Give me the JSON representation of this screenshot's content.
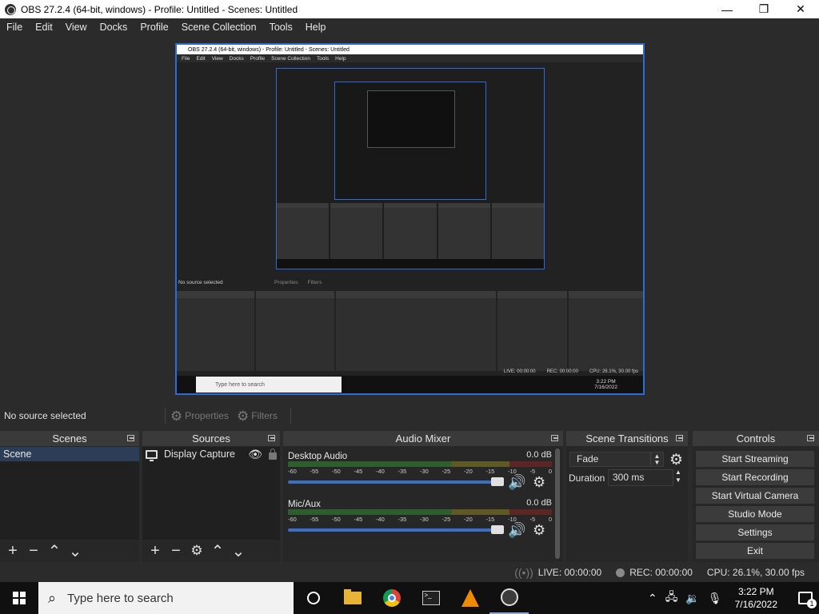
{
  "window": {
    "title": "OBS 27.2.4 (64-bit, windows) - Profile: Untitled - Scenes: Untitled",
    "minimize": "—",
    "maximize": "❐",
    "close": "✕"
  },
  "menu": [
    "File",
    "Edit",
    "View",
    "Docks",
    "Profile",
    "Scene Collection",
    "Tools",
    "Help"
  ],
  "preview": {
    "title": "OBS 27.2.4 (64-bit, windows) - Profile: Untitled - Scenes: Untitled",
    "menu": [
      "File",
      "Edit",
      "View",
      "Docks",
      "Profile",
      "Scene Collection",
      "Tools",
      "Help"
    ],
    "no_source": "No source selected",
    "properties": "Properties",
    "filters": "Filters",
    "status_live": "LIVE: 00:00:00",
    "status_rec": "REC: 00:00:00",
    "status_cpu": "CPU: 26.1%, 30.00 fps",
    "search": "Type here to search",
    "time": "3:22 PM",
    "date": "7/16/2022"
  },
  "source_toolbar": {
    "no_source": "No source selected",
    "properties": "Properties",
    "filters": "Filters"
  },
  "docks": {
    "scenes": {
      "title": "Scenes",
      "items": [
        "Scene"
      ]
    },
    "sources": {
      "title": "Sources",
      "items": [
        "Display Capture"
      ]
    },
    "mixer": {
      "title": "Audio Mixer",
      "ticks": [
        "-60",
        "-55",
        "-50",
        "-45",
        "-40",
        "-35",
        "-30",
        "-25",
        "-20",
        "-15",
        "-10",
        "-5",
        "0"
      ],
      "channels": [
        {
          "name": "Desktop Audio",
          "db": "0.0 dB",
          "volume": 1.0
        },
        {
          "name": "Mic/Aux",
          "db": "0.0 dB",
          "volume": 1.0
        }
      ]
    },
    "transitions": {
      "title": "Scene Transitions",
      "selected": "Fade",
      "duration_label": "Duration",
      "duration": "300 ms"
    },
    "controls": {
      "title": "Controls",
      "buttons": [
        "Start Streaming",
        "Start Recording",
        "Start Virtual Camera",
        "Studio Mode",
        "Settings",
        "Exit"
      ]
    }
  },
  "status": {
    "live": "LIVE: 00:00:00",
    "rec": "REC: 00:00:00",
    "cpu": "CPU: 26.1%, 30.00 fps"
  },
  "taskbar": {
    "search_placeholder": "Type here to search",
    "time": "3:22 PM",
    "date": "7/16/2022",
    "notifications": "1"
  }
}
